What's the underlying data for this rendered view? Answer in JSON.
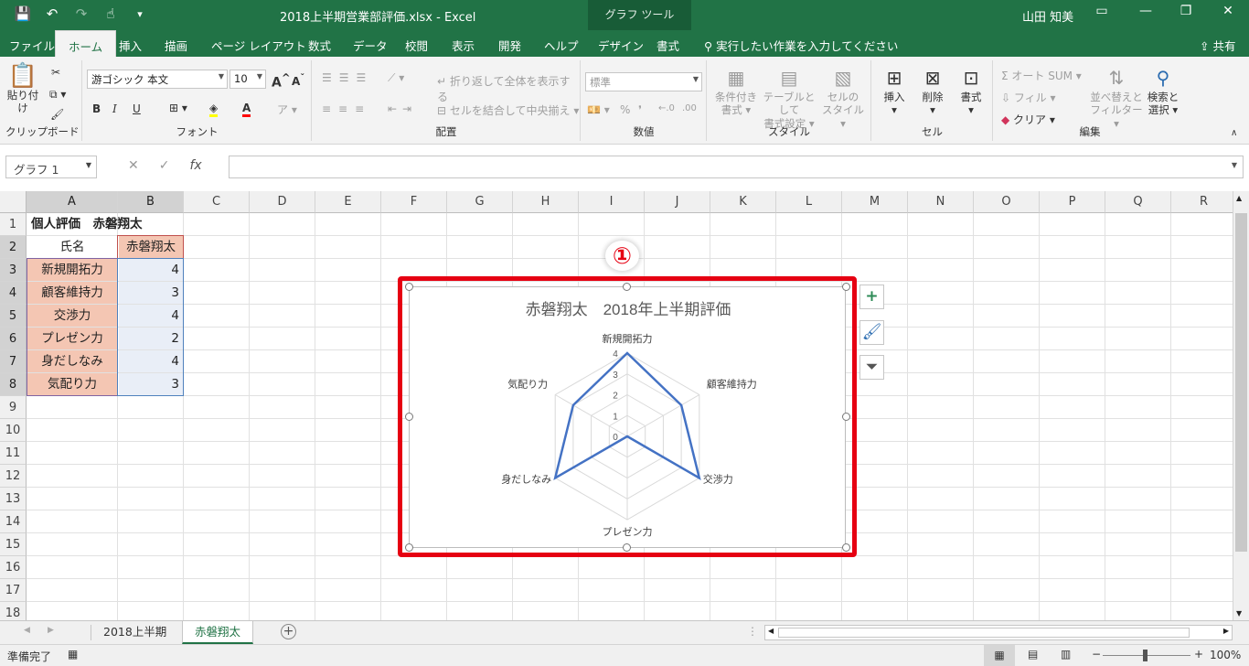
{
  "window": {
    "doc_title": "2018上半期営業部評価.xlsx  -  Excel",
    "context_tools": "グラフ ツール",
    "user": "山田 知美"
  },
  "tabs": [
    "ファイル",
    "ホーム",
    "挿入",
    "描画",
    "ページ レイアウト",
    "数式",
    "データ",
    "校閲",
    "表示",
    "開発",
    "ヘルプ",
    "デザイン",
    "書式"
  ],
  "active_tab": "ホーム",
  "tell_me": "実行したい作業を入力してください",
  "share": "共有",
  "ribbon": {
    "clipboard": {
      "paste": "貼り付け",
      "label": "クリップボード"
    },
    "font": {
      "name": "游ゴシック 本文",
      "size": "10",
      "label": "フォント",
      "bold": "B",
      "italic": "I",
      "underline": "U",
      "grow": "A",
      "shrink": "A",
      "color_a": "A"
    },
    "align": {
      "wrap": "折り返して全体を表示する",
      "merge": "セルを結合して中央揃え",
      "label": "配置"
    },
    "number": {
      "format": "標準",
      "label": "数値",
      "percent": "%"
    },
    "styles": {
      "cond": "条件付き",
      "cond2": "書式",
      "table": "テーブルとして",
      "table2": "書式設定",
      "cell": "セルの",
      "cell2": "スタイル",
      "label": "スタイル"
    },
    "cells": {
      "insert": "挿入",
      "delete": "削除",
      "format": "書式",
      "label": "セル"
    },
    "edit": {
      "autosum": "オート SUM",
      "fill": "フィル",
      "clear": "クリア",
      "sort": "並べ替えと",
      "sort2": "フィルター",
      "find": "検索と",
      "find2": "選択",
      "label": "編集"
    }
  },
  "namebox": "グラフ 1",
  "columns": [
    "A",
    "B",
    "C",
    "D",
    "E",
    "F",
    "G",
    "H",
    "I",
    "J",
    "K",
    "L",
    "M",
    "N",
    "O",
    "P",
    "Q",
    "R"
  ],
  "rows": [
    "1",
    "2",
    "3",
    "4",
    "5",
    "6",
    "7",
    "8",
    "9",
    "10",
    "11",
    "12",
    "13",
    "14",
    "15",
    "16",
    "17",
    "18"
  ],
  "cells": {
    "a1": "個人評価　赤磐翔太",
    "a2": "氏名",
    "b2": "赤磐翔太",
    "items": [
      {
        "name": "新規開拓力",
        "score": "4"
      },
      {
        "name": "顧客維持力",
        "score": "3"
      },
      {
        "name": "交渉力",
        "score": "4"
      },
      {
        "name": "プレゼン力",
        "score": "2"
      },
      {
        "name": "身だしなみ",
        "score": "4"
      },
      {
        "name": "気配り力",
        "score": "3"
      }
    ]
  },
  "annotation": "①",
  "chart_data": {
    "type": "radar",
    "title": "赤磐翔太　2018年上半期評価",
    "categories": [
      "新規開拓力",
      "顧客維持力",
      "交渉力",
      "プレゼン力",
      "身だしなみ",
      "気配り力"
    ],
    "values": [
      4,
      3,
      4,
      0,
      4,
      3
    ],
    "ticks": [
      "0",
      "1",
      "2",
      "3",
      "4"
    ],
    "rlim": [
      0,
      4
    ],
    "series_color": "#4472c4"
  },
  "sheet_tabs": [
    "2018上半期",
    "赤磐翔太"
  ],
  "active_sheet": "赤磐翔太",
  "status": {
    "ready": "準備完了",
    "zoom": "100%"
  },
  "colors": {
    "brand": "#217346",
    "highlight": "#e60012",
    "label_fill": "#f4c6b3",
    "value_fill": "#e9eef7"
  }
}
